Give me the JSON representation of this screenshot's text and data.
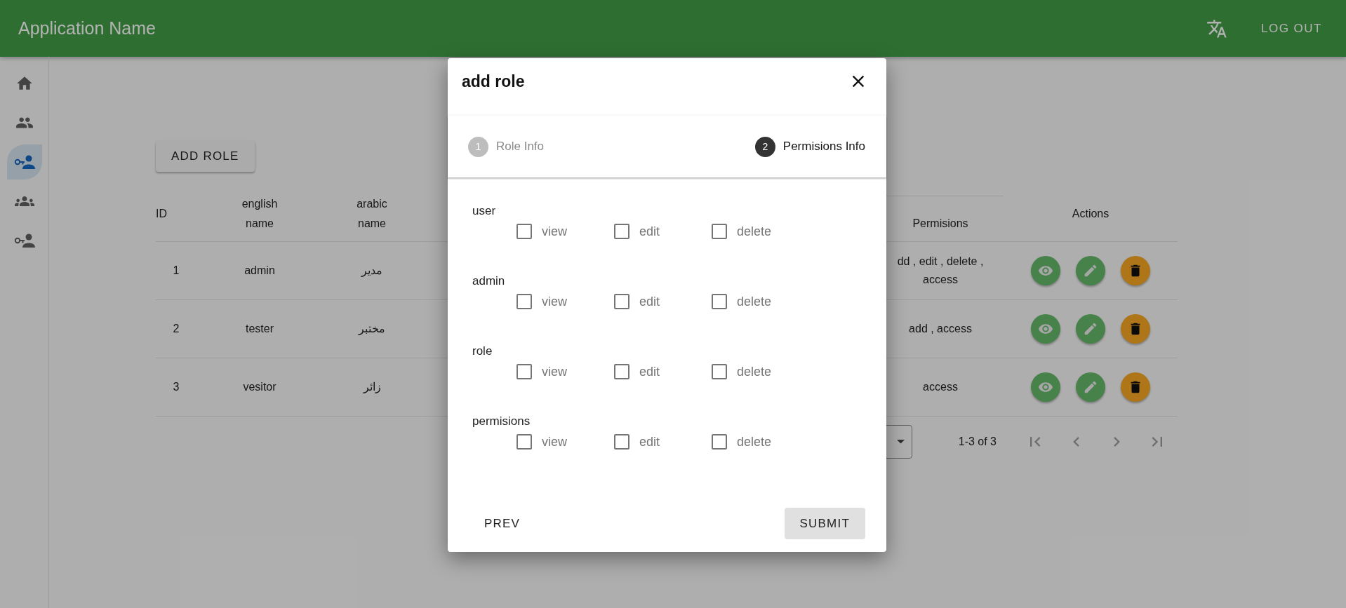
{
  "app_bar": {
    "title": "Application Name",
    "logout": "LOG OUT"
  },
  "sidebar": {
    "items": [
      {
        "kind": "home",
        "selected": false
      },
      {
        "kind": "people",
        "selected": false
      },
      {
        "kind": "key-person",
        "selected": true
      },
      {
        "kind": "group",
        "selected": false
      },
      {
        "kind": "key-person",
        "selected": false
      }
    ]
  },
  "add_role_button": "ADD ROLE",
  "table": {
    "columns": [
      "ID",
      "english name",
      "arabic name",
      "Permisions",
      "Actions"
    ],
    "rows": [
      {
        "id": "1",
        "english_name": "admin",
        "arabic_name": "مدير",
        "permissions": "dd , edit , delete , access"
      },
      {
        "id": "2",
        "english_name": "tester",
        "arabic_name": "مختبر",
        "permissions": "add , access"
      },
      {
        "id": "3",
        "english_name": "vesitor",
        "arabic_name": "زائر",
        "permissions": "access"
      }
    ]
  },
  "pagination": {
    "range": "1-3 of 3",
    "buttons": [
      {
        "kind": "first",
        "disabled": true
      },
      {
        "kind": "prev",
        "disabled": true
      },
      {
        "kind": "next",
        "disabled": true
      },
      {
        "kind": "last",
        "disabled": true
      }
    ]
  },
  "dialog": {
    "title": "add role",
    "steps": [
      {
        "number": "1",
        "label": "Role Info",
        "active": false
      },
      {
        "number": "2",
        "label": "Permisions Info",
        "active": true
      }
    ],
    "groups": [
      {
        "label": "user",
        "options": [
          {
            "label": "view",
            "checked": false
          },
          {
            "label": "edit",
            "checked": false
          },
          {
            "label": "delete",
            "checked": false
          }
        ]
      },
      {
        "label": "admin",
        "options": [
          {
            "label": "view",
            "checked": false
          },
          {
            "label": "edit",
            "checked": false
          },
          {
            "label": "delete",
            "checked": false
          }
        ]
      },
      {
        "label": "role",
        "options": [
          {
            "label": "view",
            "checked": false
          },
          {
            "label": "edit",
            "checked": false
          },
          {
            "label": "delete",
            "checked": false
          }
        ]
      },
      {
        "label": "permisions",
        "options": [
          {
            "label": "view",
            "checked": false
          },
          {
            "label": "edit",
            "checked": false
          },
          {
            "label": "delete",
            "checked": false
          }
        ]
      }
    ],
    "prev": "PREV",
    "submit": "SUBMIT"
  }
}
